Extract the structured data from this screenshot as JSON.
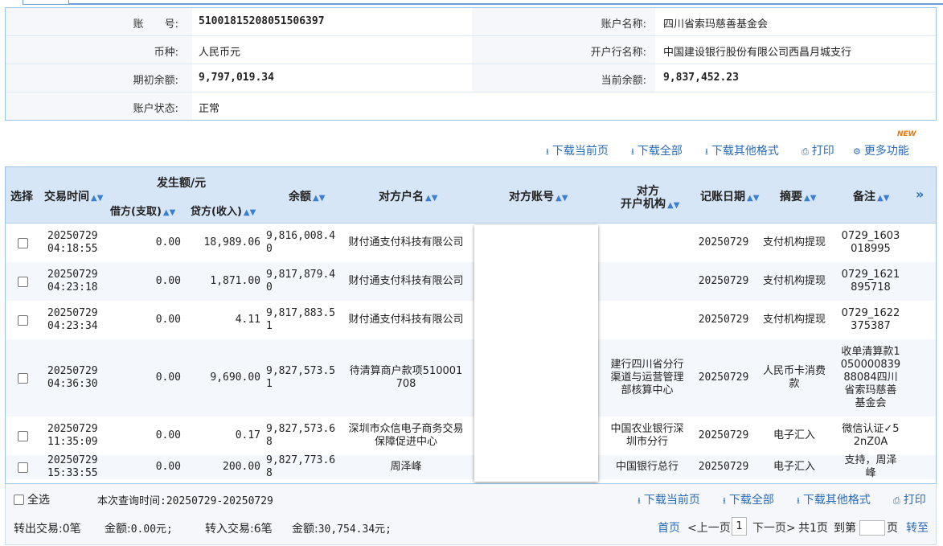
{
  "account": {
    "no_label": "账　　号:",
    "no_value": "51001815208051506397",
    "name_label": "账户名称:",
    "name_value": "四川省索玛慈善基金会",
    "currency_label": "币种:",
    "currency_value": "人民币元",
    "bank_label": "开户行名称:",
    "bank_value": "中国建设银行股份有限公司西昌月城支行",
    "opening_label": "期初余额:",
    "opening_value": "9,797,019.34",
    "current_label": "当前余额:",
    "current_value": "9,837,452.23",
    "status_label": "账户状态:",
    "status_value": "正常"
  },
  "toolbar": {
    "new_badge": "NEW",
    "download_page": "下载当前页",
    "download_all": "下载全部",
    "download_other": "下载其他格式",
    "print": "打印",
    "more": "更多功能"
  },
  "table": {
    "headers": {
      "select": "选择",
      "time": "交易时间",
      "amount_group": "发生额/元",
      "debit": "借方(支取)",
      "credit": "贷方(收入)",
      "balance": "余额",
      "counterparty_name": "对方户名",
      "counterparty_account": "对方账号",
      "counterparty_bank_1": "对方",
      "counterparty_bank_2": "开户机构",
      "post_date": "记账日期",
      "summary": "摘要",
      "remark": "备注"
    },
    "sort_icon": "▲▼",
    "expand_icon": "»",
    "rows": [
      {
        "time1": "20250729",
        "time2": "04:18:55",
        "debit": "0.00",
        "credit": "18,989.06",
        "balance": "9,816,008.40",
        "name": "财付通支付科技有限公司",
        "bank": "",
        "date": "20250729",
        "summary": "支付机构提现",
        "remark": "0729_1603018995"
      },
      {
        "time1": "20250729",
        "time2": "04:23:18",
        "debit": "0.00",
        "credit": "1,871.00",
        "balance": "9,817,879.40",
        "name": "财付通支付科技有限公司",
        "bank": "",
        "date": "20250729",
        "summary": "支付机构提现",
        "remark": "0729_1621895718"
      },
      {
        "time1": "20250729",
        "time2": "04:23:34",
        "debit": "0.00",
        "credit": "4.11",
        "balance": "9,817,883.51",
        "name": "财付通支付科技有限公司",
        "bank": "",
        "date": "20250729",
        "summary": "支付机构提现",
        "remark": "0729_1622375387"
      },
      {
        "time1": "20250729",
        "time2": "04:36:30",
        "debit": "0.00",
        "credit": "9,690.00",
        "balance": "9,827,573.51",
        "name": "待清算商户款项510001708",
        "bank": "建行四川省分行渠道与运营管理部核算中心",
        "date": "20250729",
        "summary": "人民币卡消费款",
        "remark": "收单清算款105000083988084四川省索玛慈善基金会"
      },
      {
        "time1": "20250729",
        "time2": "11:35:09",
        "debit": "0.00",
        "credit": "0.17",
        "balance": "9,827,573.68",
        "name": "深圳市众信电子商务交易保障促进中心",
        "bank": "中国农业银行深圳市分行",
        "date": "20250729",
        "summary": "电子汇入",
        "remark": "微信认证✓52nZ0A"
      },
      {
        "time1": "20250729",
        "time2": "15:33:55",
        "debit": "0.00",
        "credit": "200.00",
        "balance": "9,827,773.68",
        "name": "周泽峰",
        "bank": "中国银行总行",
        "date": "20250729",
        "summary": "电子汇入",
        "remark": "支持，周泽峰"
      }
    ]
  },
  "footer": {
    "select_all": "全选",
    "query_time_label": "本次查询时间:",
    "query_time_value": "20250729-20250729",
    "download_page": "下载当前页",
    "download_all": "下载全部",
    "download_other": "下载其他格式",
    "print": "打印",
    "out_label": "转出交易:",
    "out_count": "0笔",
    "out_amount_label": "金额:",
    "out_amount": "0.00元;",
    "in_label": "转入交易:",
    "in_count": "6笔",
    "in_amount_label": "金额:",
    "in_amount": "30,754.34元;",
    "first": "首页",
    "prev": "<上一页",
    "page_no": "1",
    "next": "下一页>",
    "total": "共1页",
    "goto_label": "到第",
    "page_unit": "页",
    "go": "转至"
  }
}
